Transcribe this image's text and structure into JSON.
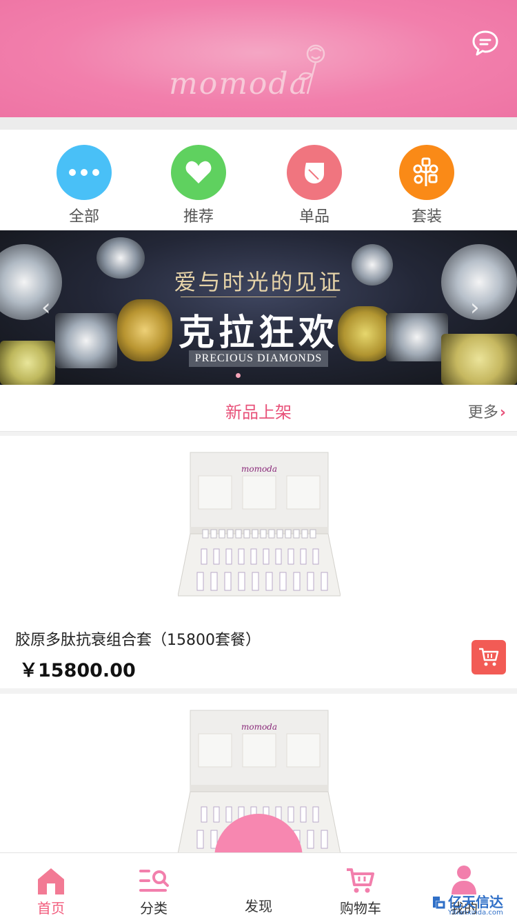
{
  "header": {
    "logo_text": "momoda",
    "chat_icon": "chat-bubble-icon"
  },
  "categories": [
    {
      "label": "全部",
      "icon": "more-dots-icon",
      "color": "#49c0f7"
    },
    {
      "label": "推荐",
      "icon": "heart-icon",
      "color": "#5fd15f"
    },
    {
      "label": "单品",
      "icon": "leaf-icon",
      "color": "#f0757f"
    },
    {
      "label": "套装",
      "icon": "flower-bundle-icon",
      "color": "#fa8a17"
    }
  ],
  "banner": {
    "title_line1": "爱与时光的见证",
    "title_line2": "克拉狂欢",
    "subtitle": "PRECIOUS DIAMONDS",
    "prev_arrow": "‹",
    "next_arrow": "›"
  },
  "section": {
    "title": "新品上架",
    "more_label": "更多",
    "more_chevron": "›"
  },
  "products": [
    {
      "name": "胶原多肽抗衰组合套（15800套餐）",
      "price": "￥15800.00",
      "image_logo": "momoda"
    },
    {
      "name": "",
      "price": "",
      "image_logo": "momoda"
    }
  ],
  "tabbar": {
    "items": [
      {
        "label": "首页",
        "icon": "home-icon",
        "active": true
      },
      {
        "label": "分类",
        "icon": "category-list-icon",
        "active": false
      },
      {
        "label": "发现",
        "icon": "search-icon",
        "active": false
      },
      {
        "label": "购物车",
        "icon": "cart-icon",
        "active": false
      },
      {
        "label": "我的",
        "icon": "user-icon",
        "active": false
      }
    ]
  },
  "watermark": {
    "text": "亿天信达",
    "sub": "Yitianxinda.com"
  },
  "colors": {
    "brand_pink": "#f27fac",
    "accent_red": "#f25b55",
    "active_tab": "#f25b7c"
  }
}
